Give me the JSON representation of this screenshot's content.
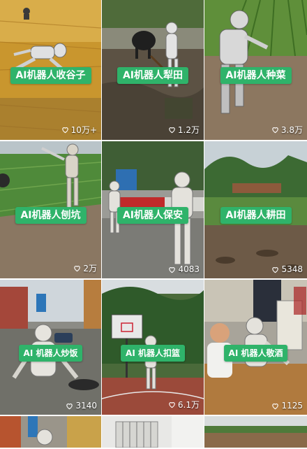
{
  "videos": [
    {
      "label": "AI机器人收谷子",
      "likes": "10万+"
    },
    {
      "label": "AI机器人犁田",
      "likes": "1.2万"
    },
    {
      "label": "AI机器人种菜",
      "likes": "3.8万"
    },
    {
      "label": "AI机器人刨坑",
      "likes": "2万"
    },
    {
      "label": "AI机器人保安",
      "likes": "4083"
    },
    {
      "label": "AI机器人耕田",
      "likes": "5348"
    },
    {
      "label": "AI 机器人炒饭",
      "likes": "3140"
    },
    {
      "label": "AI 机器人扣篮",
      "likes": "6.1万"
    },
    {
      "label": "AI 机器人敬酒",
      "likes": "1125"
    }
  ],
  "heart_icon": "heart-outline-icon",
  "colors": {
    "label_bg": "#2fb36a",
    "label_text": "#ffffff"
  }
}
